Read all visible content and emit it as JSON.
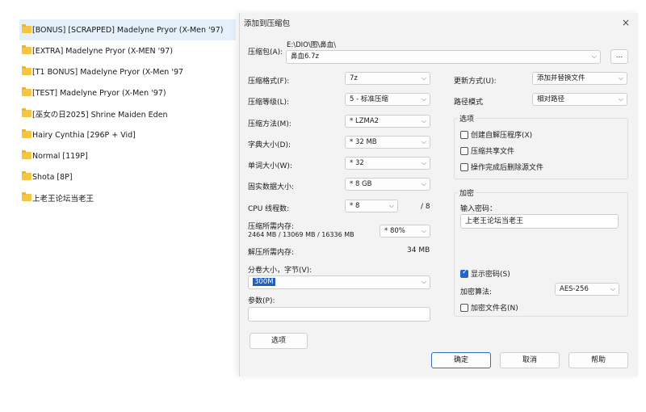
{
  "file_list": [
    {
      "name": "[BONUS] [SCRAPPED] Madelyne Pryor (X-Men '97)",
      "selected": true
    },
    {
      "name": "[EXTRA] Madelyne Pryor (X-MEN '97)",
      "selected": false
    },
    {
      "name": "[T1 BONUS] Madelyne Pryor (X-Men '97",
      "selected": false
    },
    {
      "name": "[TEST] Madelyne Pryor (X-Men '97)",
      "selected": false
    },
    {
      "name": "[巫女の日2025] Shrine Maiden Eden",
      "selected": false
    },
    {
      "name": "Hairy Cynthia [296P + Vid]",
      "selected": false
    },
    {
      "name": "Normal [119P]",
      "selected": false
    },
    {
      "name": "Shota [8P]",
      "selected": false
    },
    {
      "name": "上老王论坛当老王",
      "selected": false
    }
  ],
  "dialog": {
    "title": "添加到压缩包",
    "close": "×",
    "archive_label": "压缩包(A):",
    "archive_path": "E:\\DIO\\图\\鼻血\\",
    "archive_name": "鼻血6.7z",
    "browse": "...",
    "format_label": "压缩格式(F):",
    "format_value": "7z",
    "level_label": "压缩等级(L):",
    "level_value": "5 - 标准压缩",
    "method_label": "压缩方法(M):",
    "method_value": "* LZMA2",
    "dict_label": "字典大小(D):",
    "dict_value": "* 32 MB",
    "word_label": "单词大小(W):",
    "word_value": "* 32",
    "solid_label": "固实数据大小:",
    "solid_value": "* 8 GB",
    "threads_label": "CPU 线程数:",
    "threads_value": "* 8",
    "threads_max": "/ 8",
    "mem_comp_label": "压缩所需内存:",
    "mem_comp_detail": "2464 MB / 13069 MB / 16336 MB",
    "mem_comp_percent": "* 80%",
    "mem_decomp_label": "解压所需内存:",
    "mem_decomp_value": "34 MB",
    "split_label": "分卷大小，字节(V):",
    "split_value": "300M",
    "params_label": "参数(P):",
    "params_value": "",
    "options_button": "选项",
    "update_label": "更新方式(U):",
    "update_value": "添加并替换文件",
    "path_label": "路径模式",
    "path_value": "相对路径",
    "options_group": "选项",
    "opt_sfx": "创建自解压程序(X)",
    "opt_shared": "压缩共享文件",
    "opt_delete": "操作完成后删除源文件",
    "enc_group": "加密",
    "pwd_label": "输入密码：",
    "pwd_value": "上老王论坛当老王",
    "show_pwd": "显示密码(S)",
    "enc_method_label": "加密算法:",
    "enc_method_value": "AES-256",
    "enc_names": "加密文件名(N)",
    "ok": "确定",
    "cancel": "取消",
    "help": "帮助"
  },
  "colors": {
    "accent": "#2563c9",
    "selection": "#e5f0fb",
    "folder": "#f4c542"
  }
}
